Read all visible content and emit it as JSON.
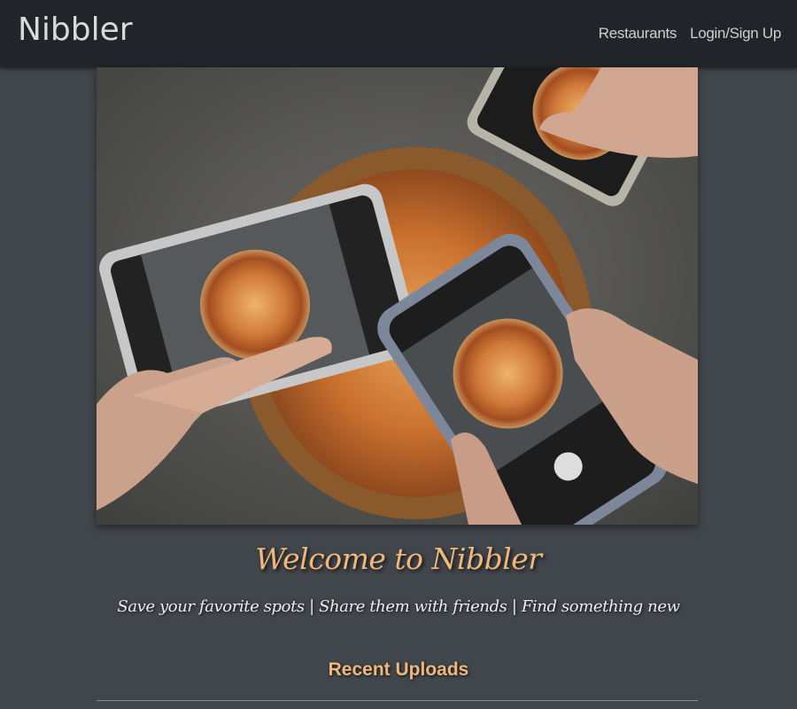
{
  "navbar": {
    "brand": "Nibbler",
    "links": [
      "Restaurants",
      "Login/Sign Up"
    ]
  },
  "hero": {
    "icon": "pizza-photo-image"
  },
  "main": {
    "title": "Welcome to Nibbler",
    "subtitle": "Save your favorite spots | Share them with friends | Find something new",
    "section_heading": "Recent Uploads"
  },
  "colors": {
    "navbar_bg": "#212529",
    "page_bg": "#41464c",
    "accent": "#f0b77b"
  }
}
